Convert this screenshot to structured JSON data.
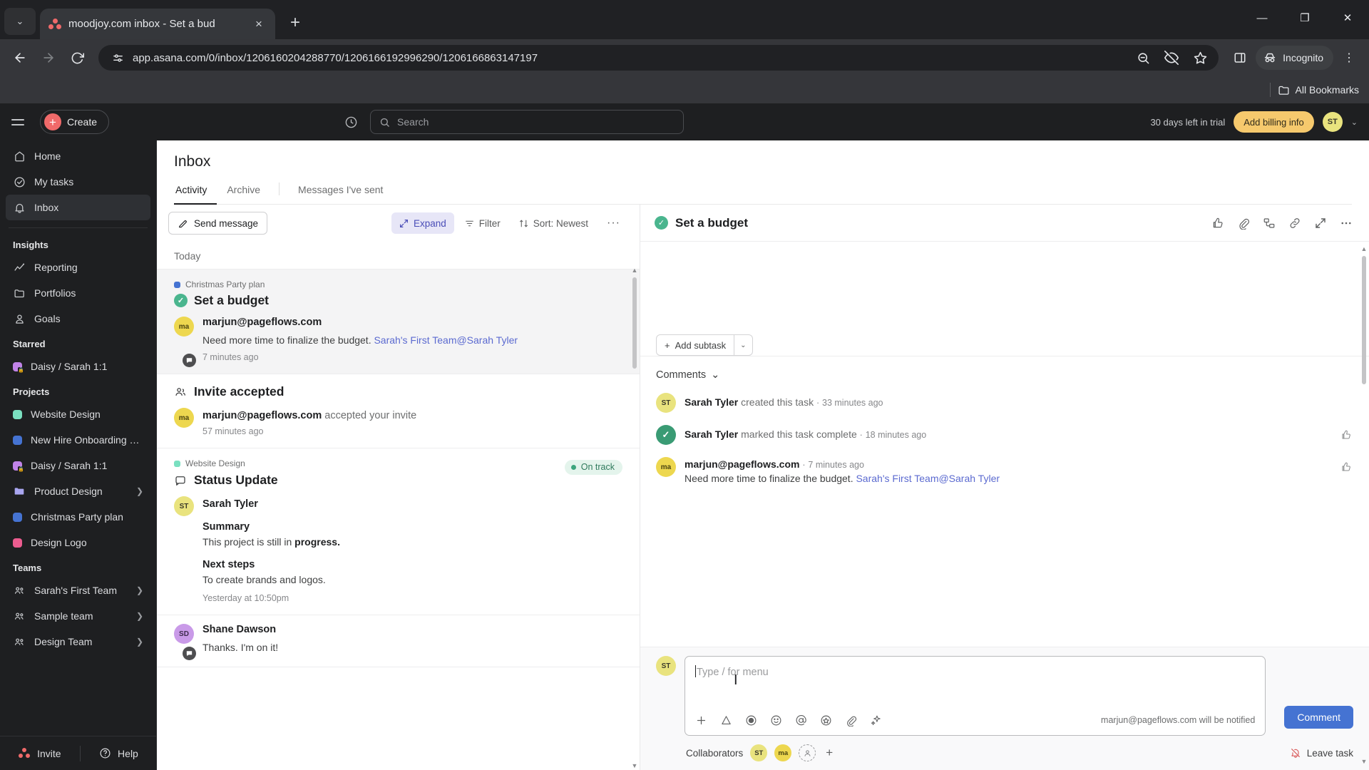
{
  "browser": {
    "tab": {
      "title": "moodjoy.com inbox - Set a bud",
      "favicon": "asana-logo-icon",
      "close": "×"
    },
    "new_tab": "+",
    "tab_list_caret": "⌄",
    "window_controls": {
      "minimize": "—",
      "maximize": "❐",
      "close": "✕"
    },
    "nav": {
      "back": "←",
      "forward": "→",
      "reload": "⟳"
    },
    "url": "app.asana.com/0/inbox/1206160204288770/1206166192996290/1206166863147197",
    "site_info_icon": "page-settings-icon",
    "omni_actions": [
      "zoom-out-icon",
      "eye-off-icon",
      "bookmark-star-icon"
    ],
    "side_panel_icon": "side-panel-icon",
    "incognito_label": "Incognito",
    "menu_icon": "⋮",
    "bookmarks_all": "All Bookmarks"
  },
  "topbar": {
    "menu_icon": "hamburger-icon",
    "create_label": "Create",
    "create_plus": "+",
    "clock_icon": "recents-clock-icon",
    "search_placeholder": "Search",
    "search_icon": "search-icon",
    "trial_text": "30 days left in trial",
    "billing_label": "Add billing info",
    "avatar_initials": "ST",
    "caret": "⌄"
  },
  "sidebar": {
    "primary": [
      {
        "label": "Home",
        "icon": "home-icon",
        "active": false
      },
      {
        "label": "My tasks",
        "icon": "check-circle-icon",
        "active": false
      },
      {
        "label": "Inbox",
        "icon": "bell-icon",
        "active": true
      }
    ],
    "insights_header": "Insights",
    "insights": [
      {
        "label": "Reporting",
        "icon": "chart-line-icon"
      },
      {
        "label": "Portfolios",
        "icon": "folder-icon"
      },
      {
        "label": "Goals",
        "icon": "goal-person-icon"
      }
    ],
    "starred_header": "Starred",
    "starred": [
      {
        "label": "Daisy / Sarah 1:1",
        "color": "#c183e8",
        "locked": true
      }
    ],
    "projects_header": "Projects",
    "projects": [
      {
        "label": "Website Design",
        "color": "#7ae0c0",
        "locked": false,
        "chevron": false
      },
      {
        "label": "New Hire Onboarding Ch...",
        "color": "#4573d2",
        "locked": false,
        "chevron": false
      },
      {
        "label": "Daisy / Sarah 1:1",
        "color": "#c183e8",
        "locked": true,
        "chevron": false
      },
      {
        "label": "Product Design",
        "color": "#a9a6f0",
        "locked": false,
        "chevron": true,
        "folder": true
      },
      {
        "label": "Christmas Party plan",
        "color": "#4573d2",
        "locked": false,
        "chevron": false
      },
      {
        "label": "Design Logo",
        "color": "#ec5c8f",
        "locked": false,
        "chevron": false
      }
    ],
    "teams_header": "Teams",
    "teams": [
      {
        "label": "Sarah's First Team",
        "icon": "people-icon",
        "chevron": true
      },
      {
        "label": "Sample team",
        "icon": "people-icon",
        "chevron": true
      },
      {
        "label": "Design Team",
        "icon": "people-icon",
        "chevron": true
      }
    ],
    "footer": {
      "invite_label": "Invite",
      "invite_icon": "asana-dots-icon",
      "help_label": "Help",
      "help_icon": "question-circle-icon"
    }
  },
  "inbox": {
    "title": "Inbox",
    "tabs": [
      {
        "label": "Activity",
        "active": true
      },
      {
        "label": "Archive",
        "active": false
      },
      {
        "label": "Messages I've sent",
        "active": false
      }
    ],
    "toolbar": {
      "send_message": "Send message",
      "send_message_icon": "compose-icon",
      "expand": "Expand",
      "expand_icon": "expand-arrows-icon",
      "filter": "Filter",
      "filter_icon": "filter-icon",
      "sort": "Sort: Newest",
      "sort_icon": "sort-icon",
      "more": "···"
    },
    "date_group": "Today",
    "items": [
      {
        "kind": "task",
        "project": "Christmas Party plan",
        "project_color": "#4573d2",
        "title": "Set a budget",
        "completed": true,
        "author": "marjun@pageflows.com",
        "author_initials": "ma",
        "text": "Need more time to finalize the budget.",
        "mention": "Sarah's First Team@Sarah Tyler",
        "time": "7 minutes ago",
        "selected": true,
        "comment_badge": true
      },
      {
        "kind": "invite",
        "heading": "Invite accepted",
        "heading_icon": "people-icon",
        "author": "marjun@pageflows.com",
        "author_initials": "ma",
        "text": "accepted your invite",
        "time": "57 minutes ago"
      },
      {
        "kind": "status",
        "project": "Website Design",
        "project_color": "#7ae0c0",
        "heading": "Status Update",
        "heading_icon": "speech-bubble-icon",
        "badge": "On track",
        "author": "Sarah Tyler",
        "author_initials": "ST",
        "summary_h": "Summary",
        "summary_p_pre": "This project is still in ",
        "summary_p_bold": "progress.",
        "next_h": "Next steps",
        "next_p": "To create brands and logos.",
        "time": "Yesterday at 10:50pm"
      },
      {
        "kind": "reply",
        "author": "Shane Dawson",
        "author_initials": "SD",
        "text": "Thanks. I'm on it!"
      }
    ]
  },
  "detail": {
    "title": "Set a budget",
    "completed": true,
    "actions": [
      "thumbs-up-icon",
      "attachment-icon",
      "subtask-icon",
      "link-icon",
      "expand-icon",
      "more-horizontal-icon"
    ],
    "add_subtask": "Add subtask",
    "add_subtask_plus": "+",
    "add_subtask_chevron": "⌄",
    "comments_header": "Comments",
    "comments_chevron": "⌄",
    "activity": [
      {
        "avatar_initials": "ST",
        "avatar_type": "st",
        "name": "Sarah Tyler",
        "action": "created this task",
        "time": "33 minutes ago",
        "has_thumb": false
      },
      {
        "avatar_initials": "✓",
        "avatar_type": "green",
        "name": "Sarah Tyler",
        "action": "marked this task complete",
        "time": "18 minutes ago",
        "has_thumb": true
      },
      {
        "avatar_initials": "ma",
        "avatar_type": "ma",
        "name": "marjun@pageflows.com",
        "action": "",
        "time": "7 minutes ago",
        "body": "Need more time to finalize the budget.",
        "mention": "Sarah's First Team@Sarah Tyler",
        "has_thumb": true
      }
    ],
    "composer": {
      "avatar_initials": "ST",
      "placeholder": "Type / for menu",
      "tools": [
        "plus-icon",
        "format-text-icon",
        "record-icon",
        "emoji-icon",
        "mention-icon",
        "sticker-icon",
        "attachment-icon",
        "ai-sparkle-icon"
      ],
      "notify_text": "marjun@pageflows.com will be notified",
      "submit_label": "Comment"
    },
    "collaborators": {
      "label": "Collaborators",
      "avatars": [
        {
          "initials": "ST",
          "type": "st"
        },
        {
          "initials": "ma",
          "type": "ma"
        }
      ],
      "add_person_icon": "add-person-icon",
      "plus": "+",
      "leave_label": "Leave task",
      "leave_icon": "bell-off-icon"
    }
  }
}
